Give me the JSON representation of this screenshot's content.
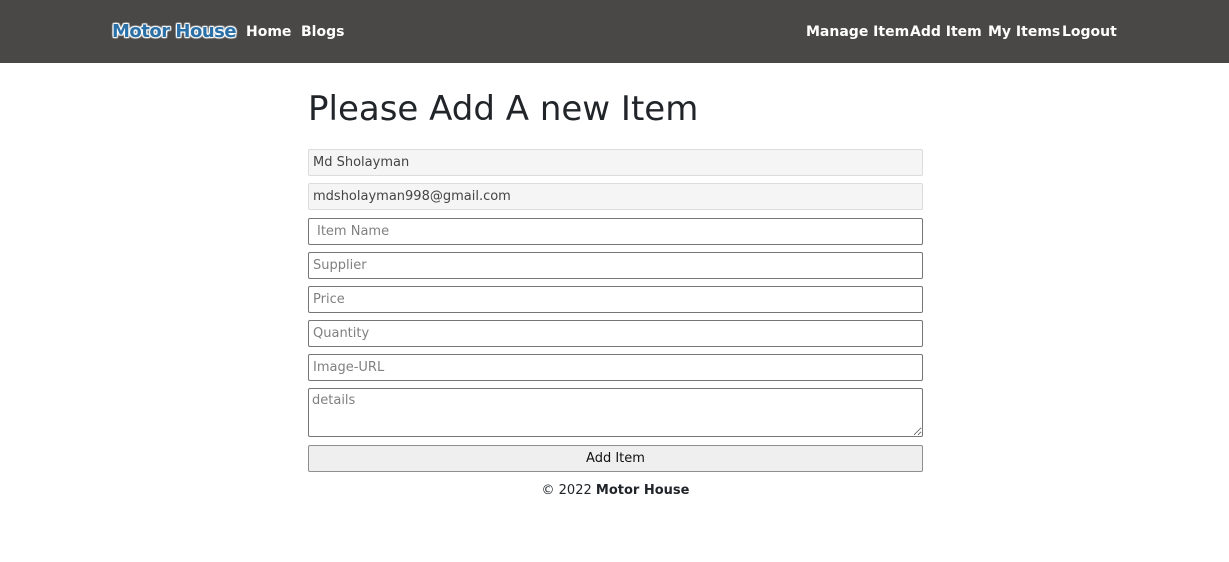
{
  "navbar": {
    "brand": "Motor House",
    "left_links": [
      "Home",
      "Blogs"
    ],
    "right_links": [
      "Manage Item",
      "Add Item",
      "My Items",
      "Logout"
    ],
    "background": "#4a4846",
    "brand_color": "#2a6fa6"
  },
  "form": {
    "title": "Please Add A new Item",
    "name_value": "Md Sholayman",
    "email_value": "mdsholayman998@gmail.com",
    "item_name_placeholder": "Item Name",
    "supplier_placeholder": "Supplier",
    "price_placeholder": "Price",
    "quantity_placeholder": "Quantity",
    "image_url_placeholder": "Image-URL",
    "details_placeholder": "details",
    "submit_label": "Add Item"
  },
  "footer": {
    "copyright": "© 2022",
    "brand": "Motor House"
  }
}
